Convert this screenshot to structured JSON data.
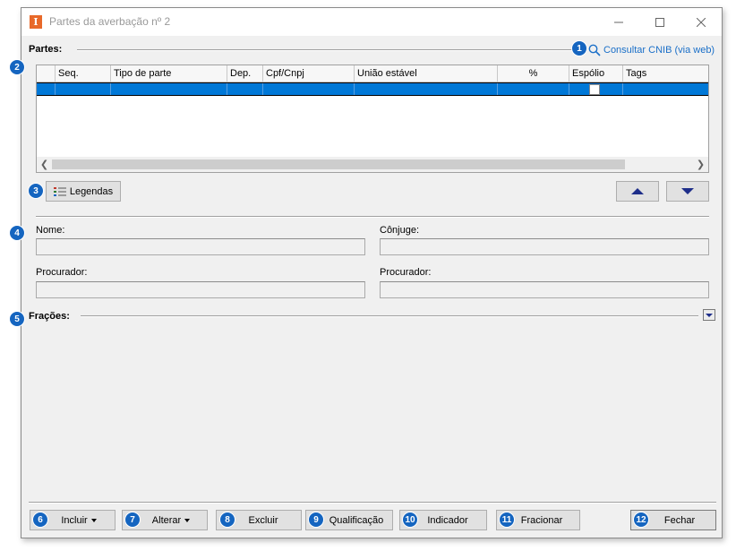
{
  "window": {
    "title": "Partes da averbação nº 2",
    "app_icon_letter": "I"
  },
  "partes": {
    "label": "Partes:",
    "cnib_link": "Consultar CNIB (via web)"
  },
  "grid": {
    "columns": [
      "Seq.",
      "Tipo de parte",
      "Dep.",
      "Cpf/Cnpj",
      "União estável",
      "%",
      "Espólio",
      "Tags"
    ]
  },
  "legendas_button": "Legendas",
  "fields": {
    "nome_label": "Nome:",
    "conjuge_label": "Cônjuge:",
    "procurador1_label": "Procurador:",
    "procurador2_label": "Procurador:"
  },
  "fracoes": {
    "label": "Frações:"
  },
  "footer": {
    "incluir": "Incluir",
    "alterar": "Alterar",
    "excluir": "Excluir",
    "qualificacao": "Qualificação",
    "indicador": "Indicador",
    "fracionar": "Fracionar",
    "fechar": "Fechar"
  },
  "badges": [
    "1",
    "2",
    "3",
    "4",
    "5",
    "6",
    "7",
    "8",
    "9",
    "10",
    "11",
    "12"
  ],
  "colors": {
    "badge": "#1565c0",
    "selection": "#0078d7",
    "link": "#1a6fc8",
    "app_icon": "#e8692a"
  }
}
